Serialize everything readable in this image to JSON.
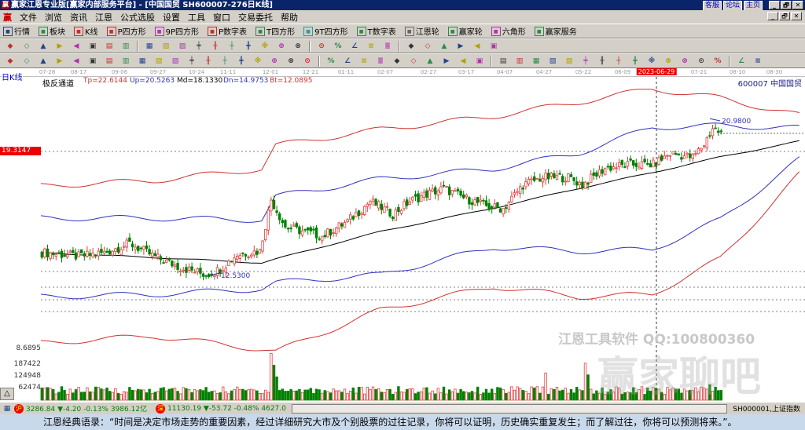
{
  "window": {
    "title": "赢家江恩专业版[赢家内部服务平台] - [中国国贸  SH600007-276日K线]",
    "links": [
      "客服",
      "论坛",
      "主页"
    ],
    "buttons": [
      "_",
      "🗗",
      "✕"
    ]
  },
  "menu": [
    "文件",
    "浏览",
    "资讯",
    "江恩",
    "公式选股",
    "设置",
    "工具",
    "窗口",
    "交易委托",
    "帮助"
  ],
  "toolbar1": [
    {
      "label": "行情",
      "icon": "quote-grid-icon",
      "color": "#224488"
    },
    {
      "label": "板块",
      "icon": "sector-blocks-icon",
      "color": "#2a8a4a"
    },
    {
      "label": "K线",
      "icon": "candlestick-icon",
      "color": "#c03030"
    },
    {
      "label": "P四方形",
      "icon": "ps-square-icon",
      "color": "#c03030"
    },
    {
      "label": "9P四方形",
      "icon": "p9-square-icon",
      "color": "#b030b0"
    },
    {
      "label": "P数字表",
      "icon": "pn-table-icon",
      "color": "#c03030"
    },
    {
      "label": "T四方形",
      "icon": "ts-square-icon",
      "color": "#2a8a4a"
    },
    {
      "label": "9T四方形",
      "icon": "t9-square-icon",
      "color": "#2a9aa0"
    },
    {
      "label": "T数字表",
      "icon": "tn-table-icon",
      "color": "#2a8a4a"
    },
    {
      "label": "江恩轮",
      "icon": "gann-wheel-icon",
      "color": "#666"
    },
    {
      "label": "赢家轮",
      "icon": "winner-wheel-icon",
      "color": "#2a8a4a"
    },
    {
      "label": "六角形",
      "icon": "hexagon-icon",
      "color": "#b030b0"
    },
    {
      "label": "赢家服务",
      "icon": "dollar-service-icon",
      "color": "#2a8a4a"
    }
  ],
  "toolbar2_icons": [
    "period-day-icon",
    "chart-style-icon",
    "info-icon",
    "indicator-icon",
    "indicator2-icon",
    "cursor-select-icon",
    "zoom-icon",
    "color-icon",
    "first-icon",
    "last-icon",
    "prev-icon",
    "next-icon",
    "diamond1-icon",
    "diamond2-icon",
    "diamond3-icon",
    "diamond4-icon",
    "diamond5-icon",
    "diamond6-icon",
    "hand-icon",
    "crosshair-icon",
    "draw-icon",
    "draw2-icon",
    "draw3-icon",
    "calendar-icon",
    "calc-icon",
    "report-icon",
    "save-icon",
    "network-icon",
    "trade-icon"
  ],
  "toolbar3_icons": [
    "pen-icon",
    "grid-icon",
    "gann-line-icon",
    "gann-line2-icon",
    "fib-icon",
    "time-icon",
    "angle-icon",
    "circle-icon",
    "hash-icon",
    "nsquare-icon",
    "arc-icon",
    "target-icon",
    "star-icon",
    "box-icon",
    "wave-icon",
    "red-line-icon",
    "red-box-icon",
    "grid2-icon",
    "span-icon",
    "square-icon",
    "fan-icon",
    "cube-icon",
    "cube2-icon",
    "angle2-icon",
    "zigzag-icon",
    "grid3-icon",
    "grid4-icon",
    "parallel-icon",
    "table-icon",
    "percent-fan-icon",
    "percent-icon",
    "percent-line-icon",
    "coin-icon",
    "gold-icon",
    "lamp-icon",
    "cross-out-icon",
    "gold2-icon",
    "angle3-icon",
    "angle4-icon",
    "angle5-icon",
    "angle6-icon",
    "angle7-icon",
    "angle8-icon",
    "yinyang-icon",
    "wave-infinity-icon"
  ],
  "period_label": "日K线",
  "dates": [
    "07-28",
    "08-17",
    "09-06",
    "09-27",
    "10-24",
    "11-11",
    "12-01",
    "12-21",
    "01-11",
    "02-07",
    "02-27",
    "03-17",
    "04-07",
    "04-27",
    "05-22",
    "06-09",
    "2023-06-29",
    "07-21",
    "08-10",
    "08-30"
  ],
  "indicator": {
    "name": "极反通道",
    "tp": "Tp=22.6144",
    "up": "Up=20.5263",
    "md": "Md=18.1330",
    "dn": "Dn=14.9753",
    "bt": "Bt=12.0895"
  },
  "stock_label": "600007  中国国贸",
  "price_tag": "19.3147",
  "bottom_price_label": "8.6895",
  "volume_labels": [
    "187422",
    "124948",
    "62474"
  ],
  "annotations": {
    "low": "12.5300",
    "high": "20.9800"
  },
  "watermark": {
    "line1": "江恩工具软件  QQ:100800360",
    "line2": "赢家聊吧"
  },
  "colors": {
    "up": "#e04040",
    "down": "#008000",
    "ma": "#000000",
    "inner_band": "#3030c0",
    "outer_band": "#d03030"
  },
  "chart_data": {
    "type": "candlestick",
    "title": "中国国贸 SH600007 日K线",
    "ylim": [
      8.6895,
      23.4
    ],
    "close_keypoints": [
      [
        1,
        13.8
      ],
      [
        13,
        13.6
      ],
      [
        22,
        13.8
      ],
      [
        31,
        14.3
      ],
      [
        41,
        13.5
      ],
      [
        49,
        13.0
      ],
      [
        58,
        12.6
      ],
      [
        63,
        12.9
      ],
      [
        69,
        13.7
      ],
      [
        77,
        13.9
      ],
      [
        81,
        16.7
      ],
      [
        86,
        15.2
      ],
      [
        94,
        14.9
      ],
      [
        99,
        14.7
      ],
      [
        108,
        15.5
      ],
      [
        116,
        16.6
      ],
      [
        124,
        15.9
      ],
      [
        130,
        16.6
      ],
      [
        136,
        17.0
      ],
      [
        142,
        17.3
      ],
      [
        149,
        16.8
      ],
      [
        158,
        16.3
      ],
      [
        163,
        16.2
      ],
      [
        170,
        17.5
      ],
      [
        177,
        17.9
      ],
      [
        186,
        17.9
      ],
      [
        191,
        17.5
      ],
      [
        199,
        18.4
      ],
      [
        208,
        18.6
      ],
      [
        216,
        18.6
      ],
      [
        222,
        19.2
      ],
      [
        230,
        19.0
      ],
      [
        234,
        19.7
      ],
      [
        237,
        20.6
      ],
      [
        240,
        20.3
      ]
    ],
    "bands": {
      "index": [
        0,
        40,
        78,
        83,
        120,
        160,
        190,
        216,
        240,
        268
      ],
      "tp": [
        17.43,
        17.73,
        18.37,
        19.65,
        20.51,
        21.23,
        22.0,
        22.73,
        22.22,
        21.28
      ],
      "up": [
        15.68,
        15.68,
        15.59,
        16.87,
        17.81,
        18.37,
        19.22,
        20.63,
        20.72,
        20.59
      ],
      "md": [
        13.8,
        13.54,
        13.24,
        13.46,
        14.95,
        16.23,
        17.3,
        18.16,
        19.01,
        19.87
      ],
      "dn": [
        11.4,
        11.53,
        11.83,
        12.17,
        12.6,
        14.1,
        13.88,
        13.97,
        15.59,
        18.88
      ],
      "bt": [
        8.88,
        9.27,
        8.54,
        8.41,
        10.68,
        11.96,
        11.4,
        11.53,
        13.46,
        18.07
      ]
    },
    "volume_ylim": [
      0,
      250000
    ],
    "volume_spikes": [
      [
        81,
        240000
      ],
      [
        82,
        180000
      ],
      [
        83,
        120000
      ],
      [
        178,
        140000
      ],
      [
        192,
        190000
      ],
      [
        193,
        130000
      ],
      [
        236,
        80000
      ]
    ]
  },
  "status": {
    "sh_badge": "沪",
    "sh": "3286.84 ▼-4.20 -0.13% 3986.12亿",
    "sz_badge": "深",
    "sz": "11130.19 ▼-53.72 -0.48% 4627.0",
    "index_name": "SH000001,上证指数"
  },
  "quote": "江恩经典语录：“时间是决定市场走势的重要因素，经过详细研究大市及个别股票的过往记录，你将可以证明，历史确实重复发生；而了解过往，你将可以预测将来。”。"
}
